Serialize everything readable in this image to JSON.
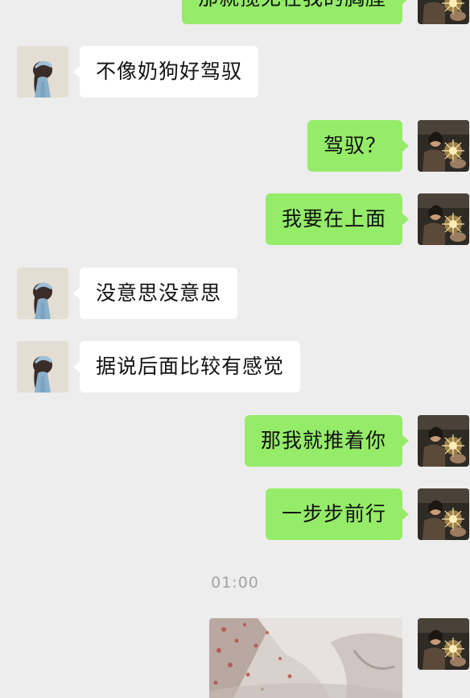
{
  "messages": [
    {
      "side": "right",
      "text": "那就揽无在我的胸膛",
      "partial": true
    },
    {
      "side": "left",
      "text": "不像奶狗好驾驭"
    },
    {
      "side": "right",
      "text": "驾驭？"
    },
    {
      "side": "right",
      "text": "我要在上面"
    },
    {
      "side": "left",
      "text": "没意思没意思"
    },
    {
      "side": "left",
      "text": "据说后面比较有感觉"
    },
    {
      "side": "right",
      "text": "那我就推着你"
    },
    {
      "side": "right",
      "text": "一步步前行"
    }
  ],
  "timestamp": "01:00",
  "image_message": {
    "side": "right",
    "type": "photo"
  },
  "colors": {
    "background": "#ededed",
    "sent_bubble": "#95ec69",
    "received_bubble": "#ffffff",
    "timestamp_text": "#a3a3a3"
  },
  "icons": {
    "left_avatar": "avatar-girl-icon",
    "right_avatar": "avatar-sparkler-icon"
  }
}
